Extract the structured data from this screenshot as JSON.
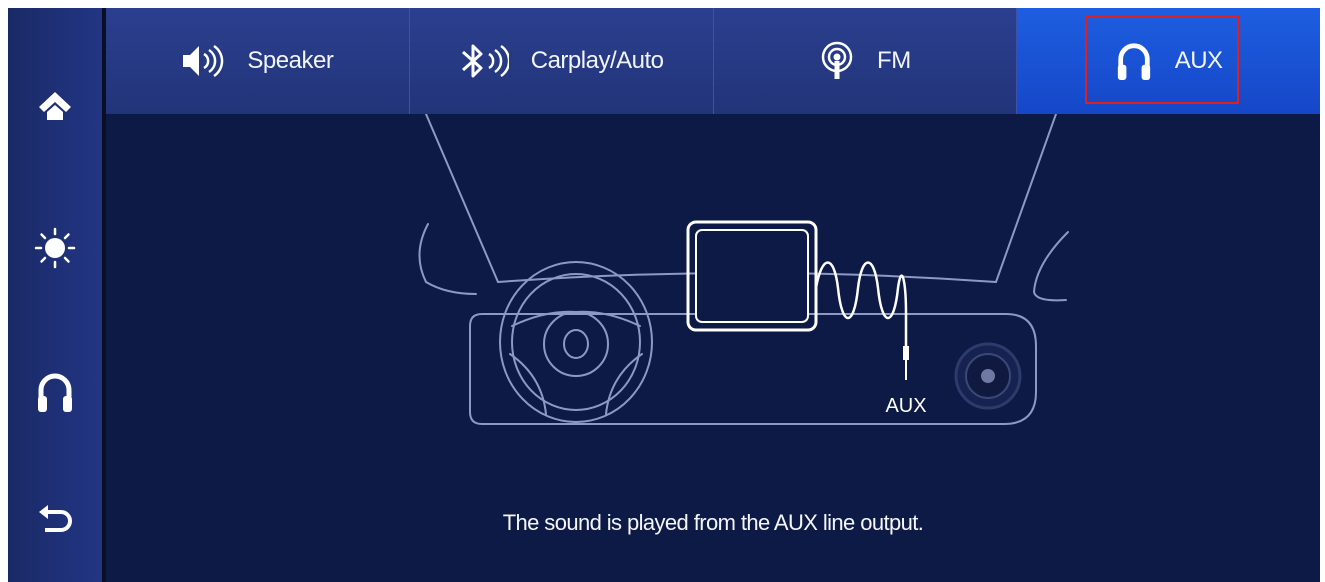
{
  "sidebar": {
    "items": [
      {
        "name": "home",
        "icon": "home-icon"
      },
      {
        "name": "brightness",
        "icon": "brightness-icon"
      },
      {
        "name": "audio",
        "icon": "headphones-icon"
      },
      {
        "name": "back",
        "icon": "back-arrow-icon"
      }
    ]
  },
  "tabs": [
    {
      "label": "Speaker",
      "icon": "speaker-icon",
      "active": false
    },
    {
      "label": "Carplay/Auto",
      "icon": "bluetooth-icon",
      "active": false
    },
    {
      "label": "FM",
      "icon": "radio-icon",
      "active": false
    },
    {
      "label": "AUX",
      "icon": "headphones-icon",
      "active": true
    }
  ],
  "illustration": {
    "port_label": "AUX"
  },
  "caption": "The sound is played from the AUX line output.",
  "colors": {
    "background": "#0d1a45",
    "tab": "#2a3f8f",
    "active_tab": "#1e5ee0",
    "highlight": "#e02020",
    "line": "#8b9ac4"
  }
}
